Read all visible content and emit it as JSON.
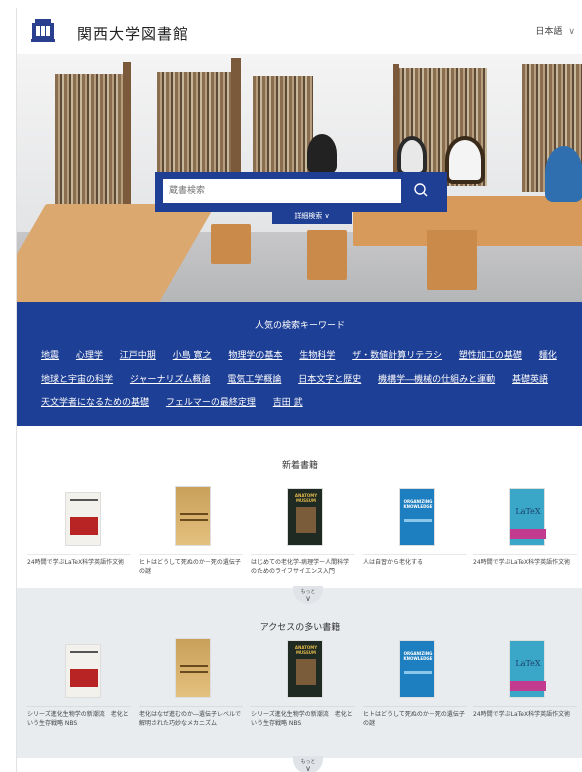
{
  "header": {
    "title": "関西大学図書館",
    "language": "日本語",
    "logo_icon": "university-crest-icon"
  },
  "search": {
    "placeholder": "蔵書検索",
    "advanced_label": "詳細検索"
  },
  "keywords": {
    "heading": "人気の検索キーワード",
    "row1": [
      "地震",
      "心理学",
      "江戸中期",
      "小島 寛之",
      "物理学の基本",
      "生物科学",
      "ザ・数値計算リテラシ",
      "塑性加工の基礎",
      "麺化"
    ],
    "row2": [
      "地球と宇宙の科学",
      "ジャーナリズム概論",
      "電気工学概論",
      "日本文字と歴史",
      "機構学―機械の仕組みと運動",
      "基礎英語"
    ],
    "row3": [
      "天文学者になるための基礎",
      "フェルマーの最終定理",
      "吉田 武"
    ]
  },
  "more_label": "もっと",
  "new_books": {
    "heading": "新着書籍",
    "items": [
      {
        "title": "24時間で学ぶLaTeX科学英語作文術",
        "cover": "red-photo"
      },
      {
        "title": "ヒトはどうして死ぬのか－死の遺伝子の謎",
        "cover": "gold-chemicals"
      },
      {
        "title": "はじめての老化学-病理学ー人間科学のためのライフサイエンス入門",
        "cover": "anatomy-museum"
      },
      {
        "title": "人は自習から老化する",
        "cover": "organizing-knowledge"
      },
      {
        "title": "24時間で学ぶLaTeX科学英語作文術",
        "cover": "latex"
      }
    ]
  },
  "access_books": {
    "heading": "アクセスの多い書籍",
    "items": [
      {
        "title": "シリーズ進化生物学の新潮流　老化という生存戦略 NBS",
        "cover": "red-photo"
      },
      {
        "title": "老化はなぜ進むのか―遺伝子レベルで解明された巧妙なメカニズム",
        "cover": "gold-chemicals"
      },
      {
        "title": "シリーズ進化生物学の新潮流　老化という生存戦略 NBS",
        "cover": "anatomy-museum"
      },
      {
        "title": "ヒトはどうして死ぬのか－死の遺伝子の謎",
        "cover": "organizing-knowledge"
      },
      {
        "title": "24時間で学ぶLaTeX科学英語作文術",
        "cover": "latex"
      }
    ]
  },
  "covers": {
    "anatomy_title": "ANATOMY MUSEUM",
    "organizing_title": "ORGANIZING KNOWLEDGE",
    "latex_title": "LaTeX"
  },
  "colors": {
    "brand_blue": "#1e3f96",
    "access_bg": "#e9ecef"
  }
}
